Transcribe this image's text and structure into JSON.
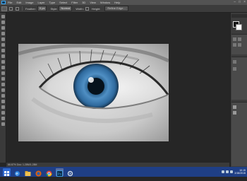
{
  "menu": {
    "items": [
      "File",
      "Edit",
      "Image",
      "Layer",
      "Type",
      "Select",
      "Filter",
      "3D",
      "View",
      "Window",
      "Help"
    ]
  },
  "options": {
    "feather_label": "Feather:",
    "feather_value": "0 px",
    "style_label": "Style:",
    "style_value": "Normal",
    "width_label": "Width:",
    "height_label": "Height:",
    "refine_label": "Refine Edge..."
  },
  "status": {
    "zoom_doc": "66.67%  Doc: 1.28M/1.28M"
  },
  "colors": {
    "accent": "#3fa9f5",
    "taskbar": "#1f3f86",
    "iris": "#4f8fc4"
  },
  "taskbar": {
    "icons": [
      "windows-start-icon",
      "ie-icon",
      "folder-icon",
      "firefox-icon",
      "chrome-icon",
      "photoshop-icon",
      "settings-icon"
    ]
  },
  "tray": {
    "time": "10:15",
    "date": "2/18/2015"
  }
}
